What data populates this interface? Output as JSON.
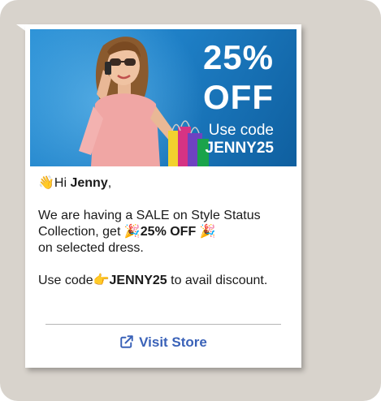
{
  "banner": {
    "discount_percent": "25%",
    "discount_off": "OFF",
    "use_code_label": "Use code",
    "code": "JENNY25"
  },
  "message": {
    "greeting_emoji": "👋",
    "greeting_hi": "Hi ",
    "greeting_name": "Jenny",
    "greeting_comma": ",",
    "line1_prefix": "We are having a SALE on Style Status Collection, get ",
    "party_emoji": "🎉",
    "offer": "25% OFF",
    "line1_suffix": "on selected dress.",
    "line2_prefix": "Use code",
    "point_emoji": "👉",
    "line2_code": "JENNY25",
    "line2_suffix": " to avail discount."
  },
  "cta": {
    "label": "Visit Store",
    "icon": "external-link-icon",
    "color": "#3a62b8"
  },
  "colors": {
    "background": "#d8d3cc",
    "banner": "#1e7fc6"
  }
}
